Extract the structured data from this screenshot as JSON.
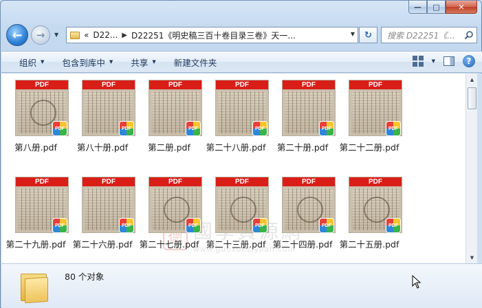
{
  "window": {
    "caption": {
      "minimize": "—",
      "maximize": "□",
      "close": "✕"
    }
  },
  "nav": {
    "back_icon": "back-arrow-icon",
    "forward_icon": "forward-arrow-icon",
    "breadcrumb": {
      "overflow": "«",
      "parent": "D22...",
      "current": "D22251《明史稿三百十卷目录三卷》天一..."
    },
    "search_placeholder": "搜索 D22251《...",
    "refresh_icon": "refresh-icon"
  },
  "toolbar": {
    "items": [
      "组织",
      "包含到库中",
      "共享",
      "新建文件夹"
    ]
  },
  "files": [
    {
      "name": "第八册.pdf"
    },
    {
      "name": "第八十册.pdf"
    },
    {
      "name": "第二册.pdf"
    },
    {
      "name": "第二十八册.pdf"
    },
    {
      "name": "第二十册.pdf"
    },
    {
      "name": "第二十二册.pdf"
    },
    {
      "name": "第二十九册.pdf"
    },
    {
      "name": "第二十六册.pdf"
    },
    {
      "name": "第二十七册.pdf"
    },
    {
      "name": "第二十三册.pdf"
    },
    {
      "name": "第二十四册.pdf"
    },
    {
      "name": "第二十五册.pdf"
    }
  ],
  "thumbnail": {
    "band_text": "PDF",
    "badge_text": "PDF"
  },
  "watermark": {
    "seal": "德",
    "text": "國學資源網",
    "url": "www.guoxueziyuan.com"
  },
  "status": {
    "count": "80 个对象"
  }
}
